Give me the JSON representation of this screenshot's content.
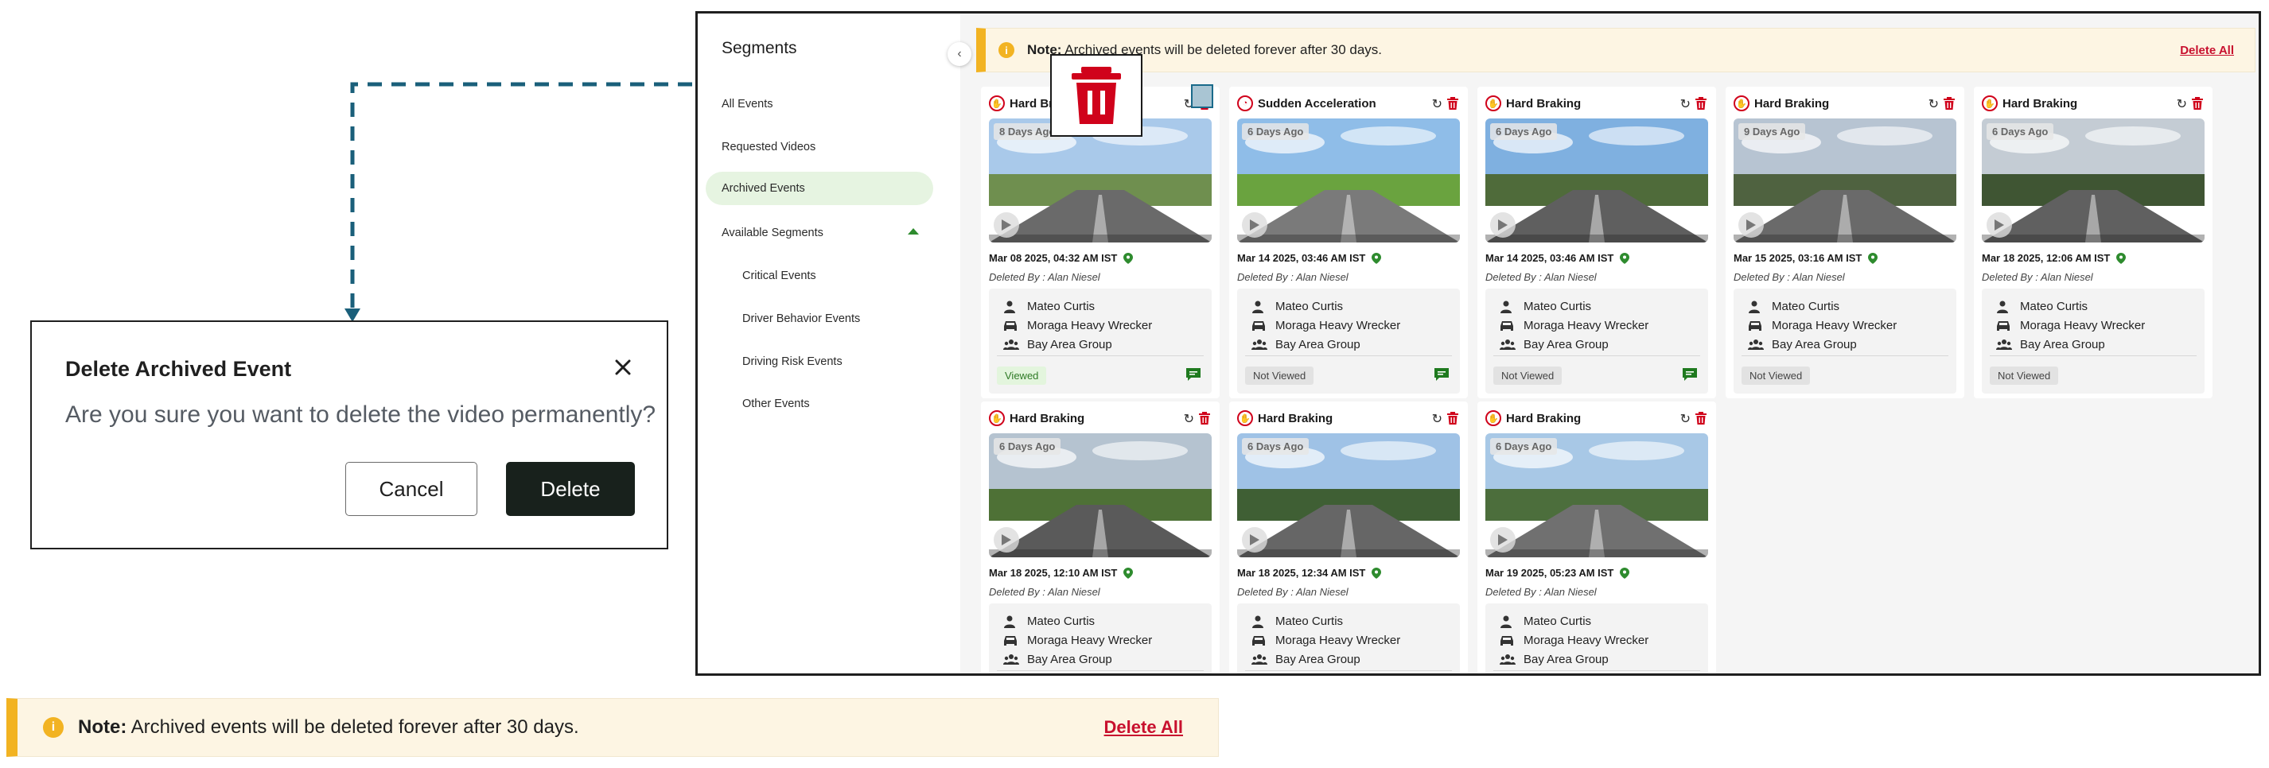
{
  "modal": {
    "title": "Delete Archived Event",
    "message": "Are you sure you want to delete the video permanently?",
    "cancel_label": "Cancel",
    "delete_label": "Delete"
  },
  "note": {
    "label": "Note:",
    "text": "Archived events will be deleted forever after 30 days.",
    "delete_all": "Delete All"
  },
  "sidebar": {
    "title": "Segments",
    "items": [
      {
        "label": "All Events"
      },
      {
        "label": "Requested Videos"
      },
      {
        "label": "Archived Events"
      },
      {
        "label": "Available Segments"
      },
      {
        "label": "Critical Events"
      },
      {
        "label": "Driver Behavior Events"
      },
      {
        "label": "Driving Risk Events"
      },
      {
        "label": "Other Events"
      }
    ]
  },
  "cards": [
    {
      "title": "Hard Braking",
      "age": "8 Days Ago",
      "date": "Mar 08 2025, 04:32 AM IST",
      "deleted_by": "Deleted By : Alan Niesel",
      "driver": "Mateo Curtis",
      "vehicle": "Moraga Heavy Wrecker",
      "group": "Bay Area Group",
      "status": "Viewed",
      "icon": "hand-stop-icon"
    },
    {
      "title": "Sudden Acceleration",
      "age": "6 Days Ago",
      "date": "Mar 14 2025, 03:46 AM IST",
      "deleted_by": "Deleted By : Alan Niesel",
      "driver": "Mateo Curtis",
      "vehicle": "Moraga Heavy Wrecker",
      "group": "Bay Area Group",
      "status": "Not Viewed",
      "icon": "speedometer-icon"
    },
    {
      "title": "Hard Braking",
      "age": "6 Days Ago",
      "date": "Mar 14 2025, 03:46 AM IST",
      "deleted_by": "Deleted By : Alan Niesel",
      "driver": "Mateo Curtis",
      "vehicle": "Moraga Heavy Wrecker",
      "group": "Bay Area Group",
      "status": "Not Viewed",
      "icon": "hand-stop-icon"
    },
    {
      "title": "Hard Braking",
      "age": "9 Days Ago",
      "date": "Mar 15 2025, 03:16 AM IST",
      "deleted_by": "Deleted By : Alan Niesel",
      "driver": "Mateo Curtis",
      "vehicle": "Moraga Heavy Wrecker",
      "group": "Bay Area Group",
      "status": "Not Viewed",
      "icon": "hand-stop-icon"
    },
    {
      "title": "Hard Braking",
      "age": "6 Days Ago",
      "date": "Mar 18 2025, 12:06 AM IST",
      "deleted_by": "Deleted By : Alan Niesel",
      "driver": "Mateo Curtis",
      "vehicle": "Moraga Heavy Wrecker",
      "group": "Bay Area Group",
      "status": "Not Viewed",
      "icon": "hand-stop-icon"
    },
    {
      "title": "Hard Braking",
      "age": "6 Days Ago",
      "date": "Mar 18 2025, 12:10 AM IST",
      "deleted_by": "Deleted By : Alan Niesel",
      "driver": "Mateo Curtis",
      "vehicle": "Moraga Heavy Wrecker",
      "group": "Bay Area Group",
      "status": "",
      "icon": "hand-stop-icon"
    },
    {
      "title": "Hard Braking",
      "age": "6 Days Ago",
      "date": "Mar 18 2025, 12:34 AM IST",
      "deleted_by": "Deleted By : Alan Niesel",
      "driver": "Mateo Curtis",
      "vehicle": "Moraga Heavy Wrecker",
      "group": "Bay Area Group",
      "status": "",
      "icon": "hand-stop-icon"
    },
    {
      "title": "Hard Braking",
      "age": "6 Days Ago",
      "date": "Mar 19 2025, 05:23 AM IST",
      "deleted_by": "Deleted By : Alan Niesel",
      "driver": "Mateo Curtis",
      "vehicle": "Moraga Heavy Wrecker",
      "group": "Bay Area Group",
      "status": "",
      "icon": "hand-stop-icon"
    }
  ],
  "colors": {
    "accent_green": "#e6f4e1",
    "danger_red": "#c8102e",
    "warning_yellow": "#f2b322",
    "connector_blue": "#1a5f7a",
    "dark_button": "#18211c"
  }
}
